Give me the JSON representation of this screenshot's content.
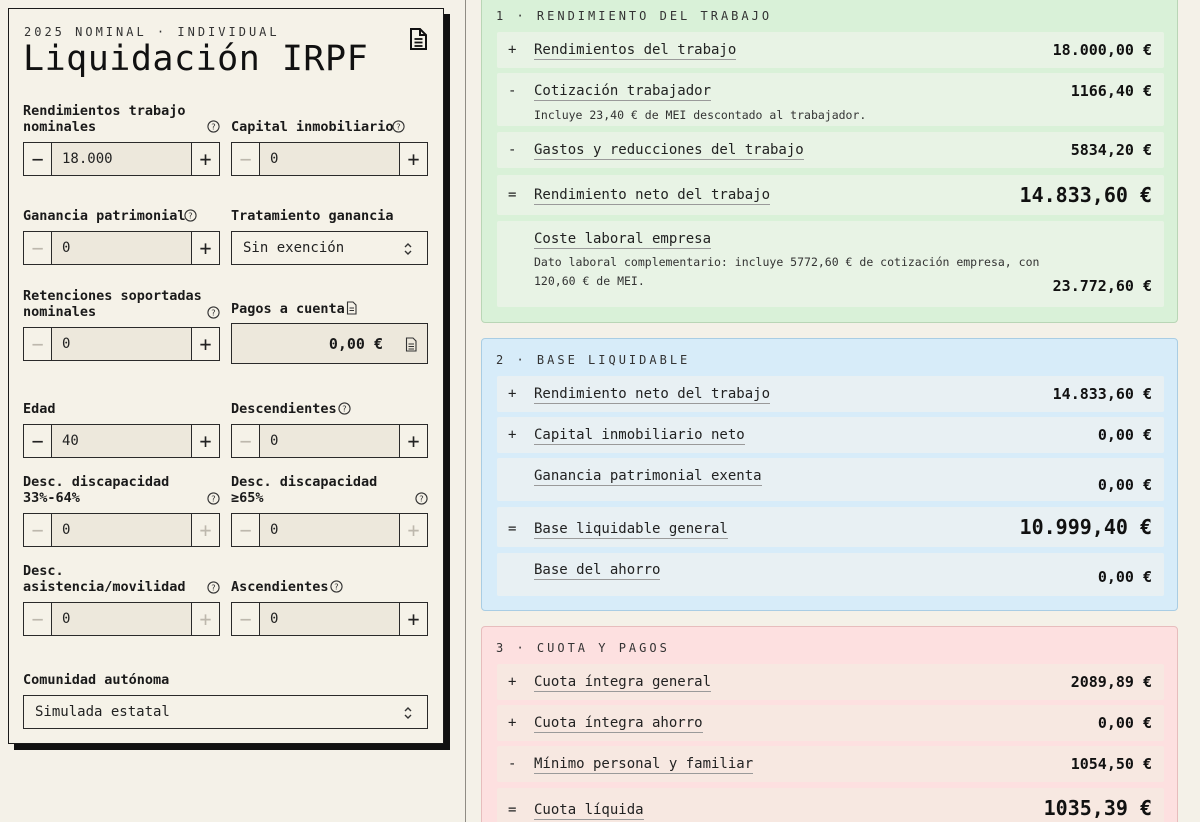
{
  "header": {
    "eyebrow": "2025 NOMINAL · INDIVIDUAL",
    "title": "Liquidación IRPF"
  },
  "fields": {
    "rend_trabajo": {
      "label_l1": "Rendimientos trabajo",
      "label_l2": "nominales",
      "value": "18.000"
    },
    "capital_inmob": {
      "label": "Capital inmobiliario",
      "value": "0"
    },
    "ganancia": {
      "label": "Ganancia patrimonial",
      "value": "0"
    },
    "tratamiento": {
      "label": "Tratamiento ganancia",
      "value": "Sin exención"
    },
    "retenciones": {
      "label_l1": "Retenciones soportadas",
      "label_l2": "nominales",
      "value": "0"
    },
    "pagos": {
      "label": "Pagos a cuenta",
      "value": "0,00 €"
    },
    "edad": {
      "label": "Edad",
      "value": "40"
    },
    "descendientes": {
      "label": "Descendientes",
      "value": "0"
    },
    "disc33": {
      "label_l1": "Desc. discapacidad",
      "label_l2": "33%-64%",
      "value": "0"
    },
    "disc65": {
      "label_l1": "Desc. discapacidad",
      "label_l2": "≥65%",
      "value": "0"
    },
    "asistencia": {
      "label_l1": "Desc.",
      "label_l2": "asistencia/movilidad",
      "value": "0"
    },
    "ascendientes": {
      "label": "Ascendientes",
      "value": "0"
    },
    "comunidad": {
      "label": "Comunidad autónoma",
      "value": "Simulada estatal"
    }
  },
  "sections": {
    "s1": {
      "title": "1 · RENDIMIENTO DEL TRABAJO",
      "rows": [
        {
          "sign": "+",
          "label": "Rendimientos del trabajo",
          "value": "18.000,00 €"
        },
        {
          "sign": "-",
          "label": "Cotización trabajador",
          "value": "1166,40 €",
          "note": "Incluye 23,40 € de MEI descontado al trabajador."
        },
        {
          "sign": "-",
          "label": "Gastos y reducciones del trabajo",
          "value": "5834,20 €"
        },
        {
          "sign": "=",
          "label": "Rendimiento neto del trabajo",
          "value": "14.833,60 €"
        },
        {
          "sign": "",
          "label": "Coste laboral empresa",
          "value": "23.772,60 €",
          "note_l1": "Dato laboral complementario: incluye 5772,60 € de cotización empresa, con",
          "note_l2": "120,60 € de MEI."
        }
      ]
    },
    "s2": {
      "title": "2 · BASE LIQUIDABLE",
      "rows": [
        {
          "sign": "+",
          "label": "Rendimiento neto del trabajo",
          "value": "14.833,60 €"
        },
        {
          "sign": "+",
          "label": "Capital inmobiliario neto",
          "value": "0,00 €"
        },
        {
          "sign": "",
          "label": "Ganancia patrimonial exenta",
          "value": "0,00 €"
        },
        {
          "sign": "=",
          "label": "Base liquidable general",
          "value": "10.999,40 €"
        },
        {
          "sign": "",
          "label": "Base del ahorro",
          "value": "0,00 €"
        }
      ]
    },
    "s3": {
      "title": "3 · CUOTA Y PAGOS",
      "rows": [
        {
          "sign": "+",
          "label": "Cuota íntegra general",
          "value": "2089,89 €"
        },
        {
          "sign": "+",
          "label": "Cuota íntegra ahorro",
          "value": "0,00 €"
        },
        {
          "sign": "-",
          "label": "Mínimo personal y familiar",
          "value": "1054,50 €"
        },
        {
          "sign": "=",
          "label": "Cuota líquida",
          "value": "1035,39 €"
        }
      ]
    }
  },
  "icons": {
    "minus": "−",
    "plus": "+"
  }
}
